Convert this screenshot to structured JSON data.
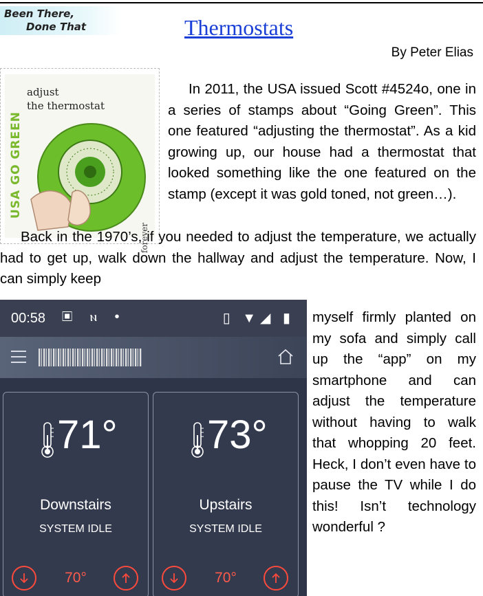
{
  "header": {
    "banner_line1": "Been There,",
    "banner_line2": "Done That",
    "title": "Thermostats",
    "byline": "By Peter Elias"
  },
  "stamp": {
    "side_text": "USA GO GREEN",
    "line1": "adjust",
    "line2": "the thermostat",
    "forever": "forever"
  },
  "article": {
    "p1": "In 2011, the USA issued Scott #4524o, one in a series of stamps about “Going Green”.  This one featured “adjusting the thermostat”.  As a kid growing up, our house had a thermostat that looked something like the one featured on the stamp (except it was gold toned, not green…).",
    "p2": "Back in the 1970’s, if you needed to adjust the temperature, we actually had to get up, walk down the hallway and adjust the temperature.  Now, I can simply keep",
    "p3": "myself firmly planted on my sofa and simply call up the “app” on my smartphone and can adjust the temperature without having to walk that whopping 20 feet. Heck, I don’t even have to pause the TV while I do this! Isn’t technology wonderful ?"
  },
  "phone": {
    "time": "00:58",
    "icons_left": "▣ ⲛ •",
    "icons_right": "▯ ▼◢ ▮",
    "zones": [
      {
        "name": "Downstairs",
        "status": "SYSTEM IDLE",
        "temp": "71°",
        "setpoint": "70°"
      },
      {
        "name": "Upstairs",
        "status": "SYSTEM IDLE",
        "temp": "73°",
        "setpoint": "70°"
      }
    ],
    "colors": {
      "accent": "#ff4a3c",
      "panel": "#343a4e"
    }
  }
}
